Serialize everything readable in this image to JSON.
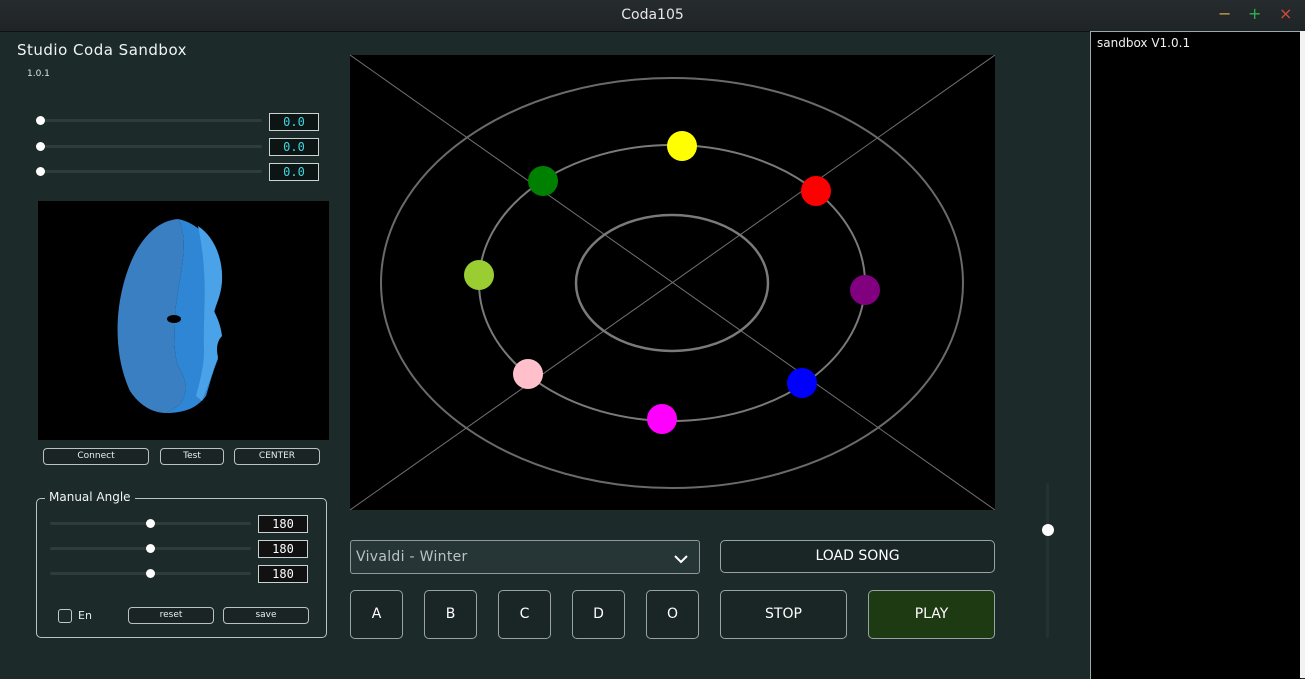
{
  "window": {
    "title": "Coda105",
    "min_glyph": "−",
    "max_glyph": "+",
    "close_glyph": "×"
  },
  "app": {
    "title": "Studio Coda Sandbox",
    "version": "1.0.1"
  },
  "top_sliders": [
    {
      "value": "0.0",
      "position": 0.0
    },
    {
      "value": "0.0",
      "position": 0.0
    },
    {
      "value": "0.0",
      "position": 0.0
    }
  ],
  "face_buttons": {
    "connect": "Connect",
    "test": "Test",
    "center": "CENTER"
  },
  "manual_angle": {
    "label": "Manual Angle",
    "sliders": [
      {
        "value": "180",
        "position": 0.5
      },
      {
        "value": "180",
        "position": 0.5
      },
      {
        "value": "180",
        "position": 0.5
      }
    ],
    "enable_label": "En",
    "enable_checked": false,
    "reset": "reset",
    "save": "save"
  },
  "radar": {
    "dots": [
      {
        "color": "#ffff00",
        "label": "yellow"
      },
      {
        "color": "#ff0000",
        "label": "red"
      },
      {
        "color": "#800080",
        "label": "purple"
      },
      {
        "color": "#0000ff",
        "label": "blue"
      },
      {
        "color": "#ff00ff",
        "label": "magenta"
      },
      {
        "color": "#ffc0cb",
        "label": "pink"
      },
      {
        "color": "#9acd32",
        "label": "yellow-green"
      },
      {
        "color": "#008000",
        "label": "green"
      }
    ]
  },
  "song": {
    "selected": "Vivaldi - Winter",
    "load": "LOAD SONG"
  },
  "controls": {
    "a": "A",
    "b": "B",
    "c": "C",
    "d": "D",
    "o": "O",
    "stop": "STOP",
    "play": "PLAY"
  },
  "volume": {
    "level": 0.75
  },
  "log": {
    "line1": "sandbox V1.0.1"
  },
  "colors": {
    "background": "#1c2a2a",
    "accent_cyan": "#3fd6e3",
    "play_bg": "#1d3a12"
  }
}
